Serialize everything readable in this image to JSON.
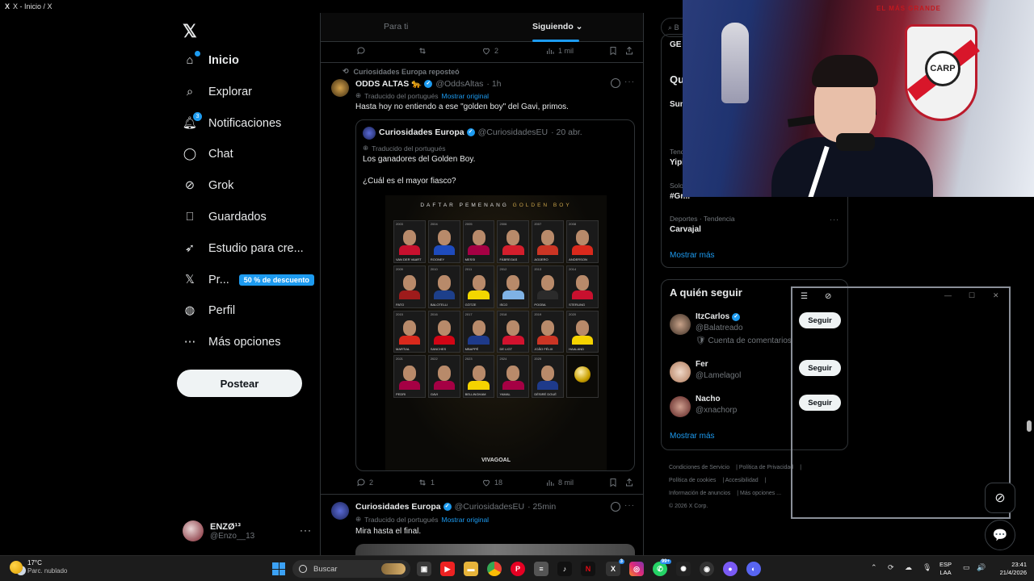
{
  "window": {
    "title": "X - Inicio / X"
  },
  "nav": {
    "items": [
      {
        "label": "Inicio",
        "icon": "home-icon",
        "active": true
      },
      {
        "label": "Explorar",
        "icon": "search-icon"
      },
      {
        "label": "Notificaciones",
        "icon": "bell-icon",
        "badge": "3"
      },
      {
        "label": "Chat",
        "icon": "chat-icon"
      },
      {
        "label": "Grok",
        "icon": "grok-icon"
      },
      {
        "label": "Guardados",
        "icon": "bookmark-icon"
      },
      {
        "label": "Estudio para cre...",
        "icon": "rocket-icon"
      },
      {
        "label": "Pr...",
        "icon": "x-premium-icon",
        "promo": "50 % de descuento"
      },
      {
        "label": "Perfil",
        "icon": "person-icon"
      },
      {
        "label": "Más opciones",
        "icon": "more-circle-icon"
      }
    ],
    "post_button": "Postear",
    "user": {
      "name": "ENZØ¹³",
      "handle": "@Enzo__13"
    }
  },
  "timeline": {
    "tabs": [
      {
        "label": "Para ti"
      },
      {
        "label": "Siguiendo",
        "active": true
      }
    ],
    "prev_actions": {
      "replies": "",
      "reposts": "",
      "likes": "2",
      "views": "1 mil"
    },
    "post1": {
      "repost_by": "Curiosidades Europa reposteó",
      "name": "ODDS ALTAS",
      "emoji": "🐆",
      "handle": "@OddsAltas",
      "time": "· 1h",
      "translated": "Traducido del portugués",
      "show_original": "Mostrar original",
      "text": "Hasta hoy no entiendo a ese \"golden boy\" del Gavi, primos.",
      "quote": {
        "name": "Curiosidades Europa",
        "handle": "@CuriosidadesEU",
        "time": "· 20 abr.",
        "translated": "Traducido del portugués",
        "text1": "Los ganadores del Golden Boy.",
        "text2": "¿Cuál es el mayor fiasco?",
        "image": {
          "title_a": "DAFTAR PEMENANG",
          "title_b": "GOLDEN BOY",
          "brand": "VIVAGOAL",
          "players": [
            {
              "year": "2003",
              "name": "VAN DER VAART",
              "color": "#c8102e"
            },
            {
              "year": "2004",
              "name": "ROONEY",
              "color": "#1e4bbd"
            },
            {
              "year": "2005",
              "name": "MESSI",
              "color": "#a50044"
            },
            {
              "year": "2006",
              "name": "FÀBREGAS",
              "color": "#d41e2c"
            },
            {
              "year": "2007",
              "name": "AGÜERO",
              "color": "#cb3524"
            },
            {
              "year": "2008",
              "name": "ANDERSON",
              "color": "#da291c"
            },
            {
              "year": "2009",
              "name": "PATO",
              "color": "#9e1b1b"
            },
            {
              "year": "2010",
              "name": "BALOTELLI",
              "color": "#1d3f8a"
            },
            {
              "year": "2011",
              "name": "GÖTZE",
              "color": "#f2d600"
            },
            {
              "year": "2012",
              "name": "ISCO",
              "color": "#7fb2e5"
            },
            {
              "year": "2013",
              "name": "POGBA",
              "color": "#2b2b2b"
            },
            {
              "year": "2014",
              "name": "STERLING",
              "color": "#c8102e"
            },
            {
              "year": "2015",
              "name": "MARTIAL",
              "color": "#da291c"
            },
            {
              "year": "2016",
              "name": "SANCHES",
              "color": "#d20515"
            },
            {
              "year": "2017",
              "name": "MBAPPÉ",
              "color": "#1e3a8a"
            },
            {
              "year": "2018",
              "name": "DE LIGT",
              "color": "#d2122e"
            },
            {
              "year": "2019",
              "name": "JOÃO FÉLIX",
              "color": "#cb3524"
            },
            {
              "year": "2020",
              "name": "HAALAND",
              "color": "#f5d300"
            },
            {
              "year": "2021",
              "name": "PEDRI",
              "color": "#a50044"
            },
            {
              "year": "2022",
              "name": "GAVI",
              "color": "#a50044"
            },
            {
              "year": "2023",
              "name": "BELLINGHAM",
              "color": "#f5d300"
            },
            {
              "year": "2024",
              "name": "YAMAL",
              "color": "#a50044"
            },
            {
              "year": "2025",
              "name": "DÉSIRÉ DOUÉ",
              "color": "#1e3a8a"
            },
            {
              "year": "",
              "name": "",
              "color": "#000000",
              "trophy": true
            }
          ]
        }
      },
      "actions": {
        "replies": "2",
        "reposts": "1",
        "likes": "18",
        "views": "8 mil"
      }
    },
    "post2": {
      "name": "Curiosidades Europa",
      "handle": "@CuriosidadesEU",
      "time": "· 25min",
      "translated": "Traducido del portugués",
      "show_original": "Mostrar original",
      "text": "Mira hasta el final."
    }
  },
  "sidebar": {
    "search_placeholder": "B",
    "trending": {
      "title": "Qu",
      "items": [
        {
          "cat": "",
          "name": "GE"
        },
        {
          "cat": "",
          "name": "Sun"
        },
        {
          "cat": "Tend",
          "name": "Yipi"
        },
        {
          "cat": "Solo",
          "name": "#Gr..."
        },
        {
          "cat": "Deportes · Tendencia",
          "name": "Carvajal"
        }
      ],
      "show_more": "Mostrar más"
    },
    "who_to_follow": {
      "title": "A quién seguir",
      "users": [
        {
          "name": "ItzCarlos",
          "handle": "@Balatreado",
          "desc": "Cuenta de comentarios",
          "verified": true
        },
        {
          "name": "Fer",
          "handle": "@Lamelagol",
          "desc": ""
        },
        {
          "name": "Nacho",
          "handle": "@xnachorp",
          "desc": ""
        }
      ],
      "follow_label": "Seguir",
      "show_more": "Mostrar más"
    },
    "footer": [
      "Condiciones de Servicio",
      "Política de Privacidad",
      "Política de cookies",
      "Accesibilidad",
      "Información de anuncios",
      "Más opciones ...",
      "© 2026 X Corp."
    ]
  },
  "webcam": {
    "banner": "EL MÁS GRANDE",
    "crest": "CARP"
  },
  "taskbar": {
    "weather_temp": "17°C",
    "weather_desc": "Parc. nublado",
    "search": "Buscar",
    "badges": {
      "x": "3",
      "whatsapp": "99+"
    },
    "lang_a": "ESP",
    "lang_b": "LAA",
    "time": "23:41",
    "date": "21/4/2026"
  }
}
